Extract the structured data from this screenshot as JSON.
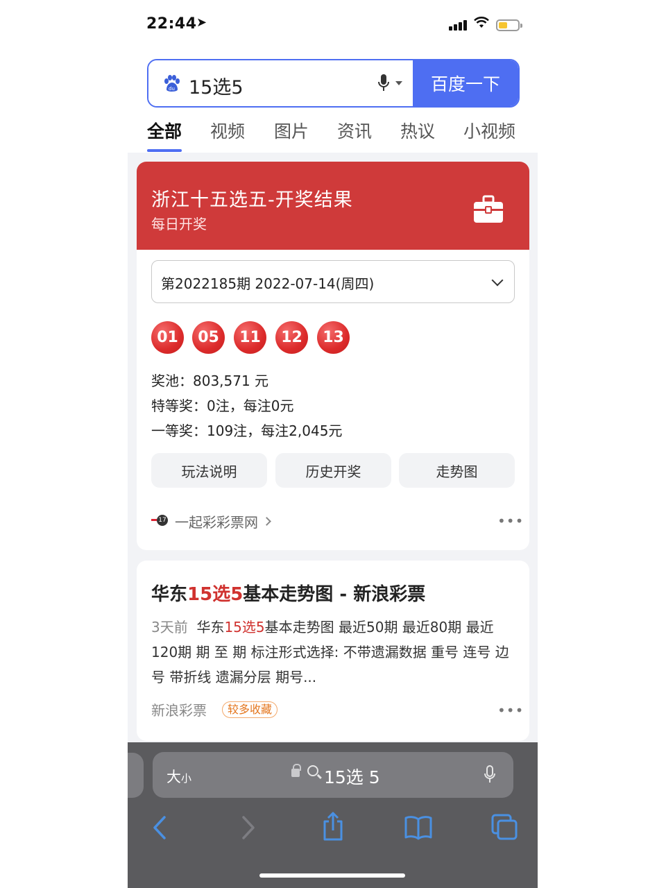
{
  "status_bar": {
    "time": "22:44",
    "location_glyph": "➤",
    "wifi_glyph": "ᯤ",
    "battery_color": "#f6c531"
  },
  "search": {
    "query": "15选5",
    "button_label": "百度一下",
    "accent": "#4e6ef2",
    "logo_icon": "baidu-paw-icon"
  },
  "tabs": [
    {
      "label": "全部",
      "active": true
    },
    {
      "label": "视频",
      "active": false
    },
    {
      "label": "图片",
      "active": false
    },
    {
      "label": "资讯",
      "active": false
    },
    {
      "label": "热议",
      "active": false
    },
    {
      "label": "小视频",
      "active": false
    }
  ],
  "lottery_card": {
    "title": "浙江十五选五-开奖结果",
    "subtitle": "每日开奖",
    "banner_color": "#cf3a3a",
    "period_select": "第2022185期  2022-07-14(周四)",
    "balls": [
      "01",
      "05",
      "11",
      "12",
      "13"
    ],
    "pool": "奖池：803,571 元",
    "special_prize": "特等奖：0注，每注0元",
    "first_prize": "一等奖：109注，每注2,045元",
    "buttons": [
      "玩法说明",
      "历史开奖",
      "走势图"
    ],
    "source": "一起彩彩票网",
    "more": "•••"
  },
  "result_card": {
    "title_pre": "华东",
    "title_hl": "15选5",
    "title_post": "基本走势图 - 新浪彩票",
    "date": "3天前",
    "snippet_pre": "华东",
    "snippet_hl": "15选5",
    "snippet_post": "基本走势图 最近50期 最近80期 最近120期 期 至 期 标注形式选择: 不带遗漏数据 重号 连号 边号 带折线 遗漏分层 期号...",
    "source": "新浪彩票",
    "badge": "较多收藏",
    "more": "•••"
  },
  "browser": {
    "text_size_main": "大",
    "text_size_small": "小",
    "url": "15选 5",
    "nav_icons": [
      "back-icon",
      "forward-icon",
      "share-icon",
      "bookmarks-icon",
      "tabs-icon"
    ]
  }
}
